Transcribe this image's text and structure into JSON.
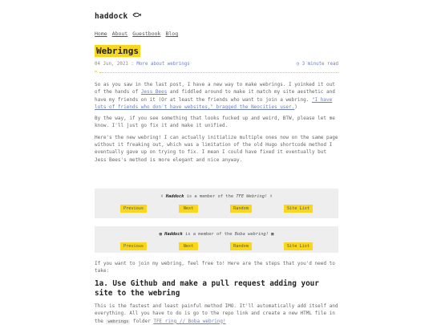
{
  "site": {
    "brand": "haddock",
    "brand_icon": "fish-icon"
  },
  "nav": [
    "Home",
    "About",
    "Guestbook",
    "Blog"
  ],
  "post": {
    "title": "Webrings",
    "date": "04 Jun, 2021",
    "sep": ":",
    "more_link": "More about webrings",
    "read_time": "3 minute read",
    "p1a": "So as you saw in the last post, I have a new way to make webrings. I yoinked it out of the hands of ",
    "p1_link1": "Jess Bees",
    "p1b": " and fiddled around to make it match my site aesthetic and have my friends on it (Or at least the friends who want to join a webring. ",
    "p1_link2": "\"I have lots of friends who don't have websites,\" bragged the Neocities user.",
    "p1c": ")",
    "p2": "By the way, if you see something that looks fucked up and weird, BTW, please let me know. I'll just go fix it and make it unified.",
    "p3": "Here's the new webring! I can actually initialize multiple ones now on the same page without it freaking out, which was a limitation of the old Hugo shortcode method I eventually gave up on trying to fix. I mean I could have fixed it eventually but Jess Bees's method is more elegant and nice anyway.",
    "after_rings": "If you want to join my webring, feel free to! Here are the steps that you'd need to take:",
    "h2": "1a. Use Github and make a pull request adding your site to the webring",
    "p4a": "This is the fastest and least painful method IMO. It'll automatically add itself and everything. All you have to do is go to the repo link and create a new HTML file in the ",
    "p4_code": "webrings",
    "p4b": " folder ",
    "p4_link": "TFE ring // Boba webring!"
  },
  "rings": [
    {
      "pre": "is a member of the",
      "name": "Haddock",
      "ring": "TFE Webring!",
      "icon": "fish-icon",
      "buttons": [
        "Previous",
        "Next",
        "Random",
        "Site List"
      ]
    },
    {
      "pre": "is a member of the",
      "name": "Haddock",
      "ring": "Boba webring!",
      "icon": "boba-icon",
      "buttons": [
        "Previous",
        "Next",
        "Random",
        "Site List"
      ]
    }
  ]
}
